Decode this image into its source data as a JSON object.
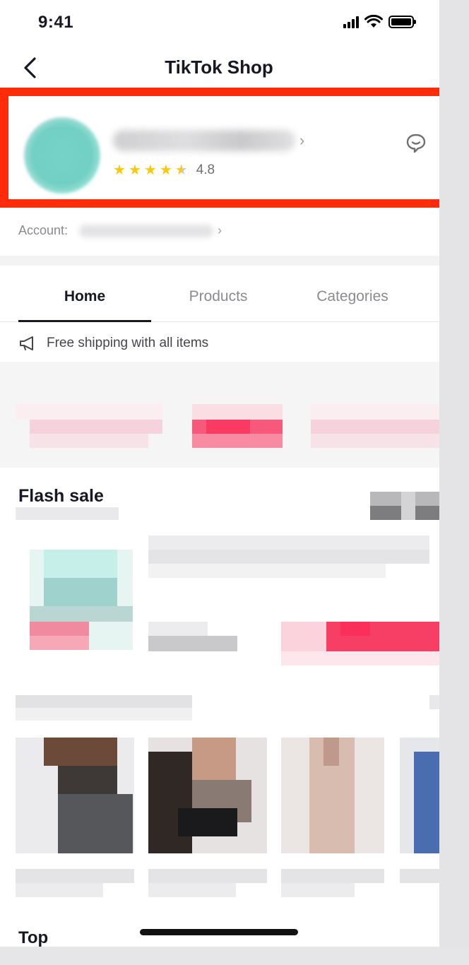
{
  "status_bar": {
    "time": "9:41"
  },
  "nav": {
    "title": "TikTok Shop"
  },
  "shop": {
    "rating": "4.8",
    "stars": 4.5
  },
  "account": {
    "label": "Account:"
  },
  "tabs": [
    {
      "label": "Home",
      "active": true
    },
    {
      "label": "Products",
      "active": false
    },
    {
      "label": "Categories",
      "active": false
    }
  ],
  "announcement": {
    "text": "Free shipping with all items"
  },
  "flash_sale": {
    "title": "Flash sale"
  },
  "next_section": {
    "title": "Top"
  },
  "colors": {
    "highlight": "#fe2c0b",
    "star": "#fac814",
    "accent": "#fe2c55"
  }
}
